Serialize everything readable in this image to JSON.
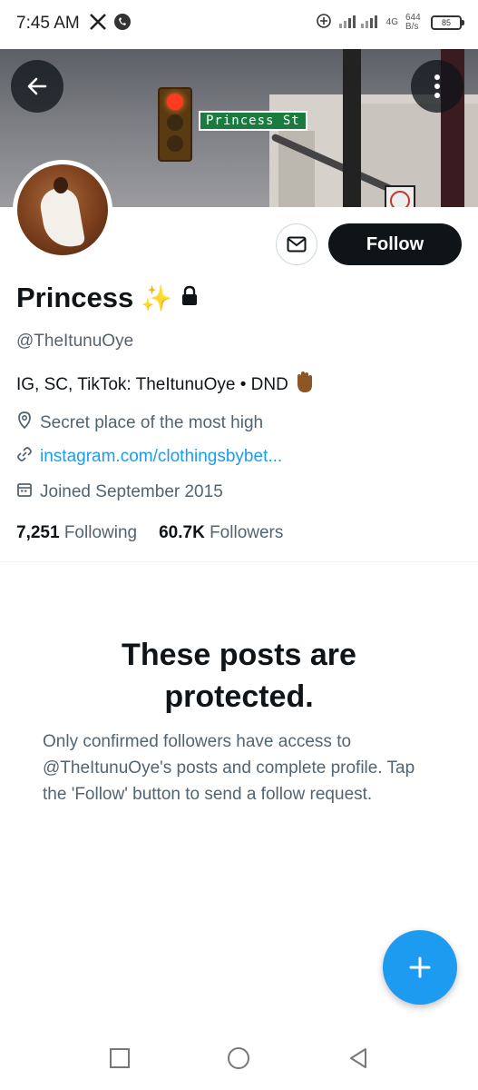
{
  "status_bar": {
    "time": "7:45 AM",
    "network": "4G",
    "speed": "644 B/s",
    "battery": "85"
  },
  "banner": {
    "street_sign": "Princess St"
  },
  "profile": {
    "display_name": "Princess",
    "handle": "@TheItunuOye",
    "bio": "IG, SC, TikTok: TheItunuOye • DND",
    "location": "Secret place of the most high",
    "website": "instagram.com/clothingsbybet...",
    "joined": "Joined September 2015",
    "following_count": "7,251",
    "following_label": "Following",
    "followers_count": "60.7K",
    "followers_label": "Followers"
  },
  "actions": {
    "follow_label": "Follow"
  },
  "protected": {
    "title_line1": "These posts are",
    "title_line2": "protected.",
    "body": "Only confirmed followers have access to @TheItunuOye's posts and complete profile. Tap the 'Follow' button to send a follow request."
  },
  "colors": {
    "accent": "#1d9bf0",
    "text_primary": "#0f1419",
    "text_secondary": "#536471"
  }
}
